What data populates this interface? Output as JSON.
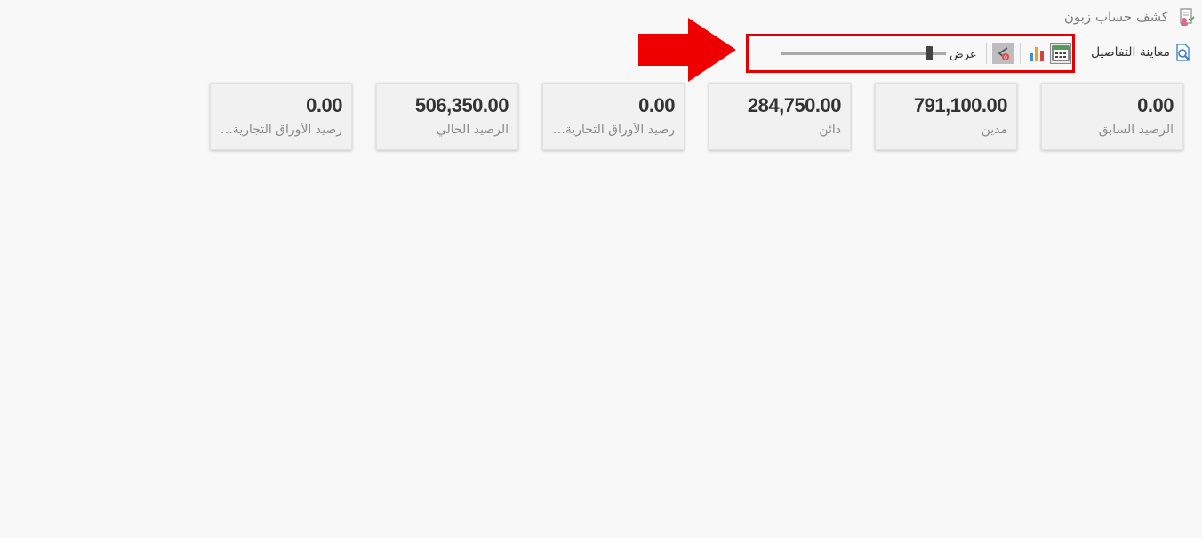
{
  "header": {
    "title": "كشف حساب زبون",
    "title_icon": "customer-statement-icon"
  },
  "toolbar": {
    "details_label": "معاينة التفاصيل",
    "details_icon": "search-document-icon",
    "width_label": "عرض",
    "width_slider_value": 0.9,
    "tools": [
      {
        "name": "card-view-icon"
      },
      {
        "name": "bar-chart-icon"
      },
      {
        "name": "reset-icon"
      }
    ],
    "highlight_color": "#e00000"
  },
  "cards": [
    {
      "value": "0.00",
      "label": "الرصيد السابق"
    },
    {
      "value": "791,100.00",
      "label": "مدين"
    },
    {
      "value": "284,750.00",
      "label": "دائن"
    },
    {
      "value": "0.00",
      "label": "رصيد الأوراق التجارية المدينة"
    },
    {
      "value": "506,350.00",
      "label": "الرصيد الحالي"
    },
    {
      "value": "0.00",
      "label": "رصيد الأوراق التجارية الدائنة"
    }
  ]
}
